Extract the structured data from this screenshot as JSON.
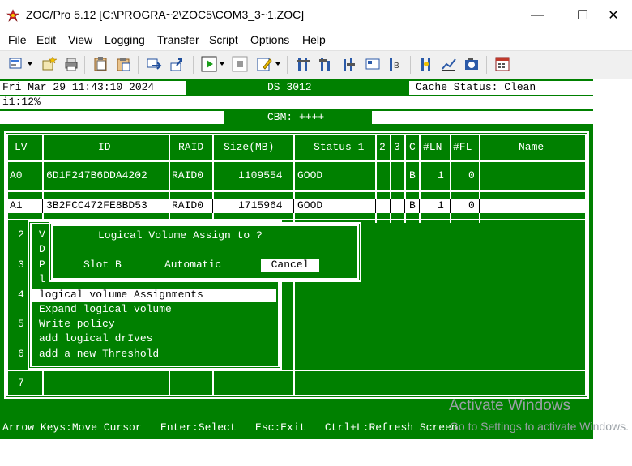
{
  "window": {
    "title": "ZOC/Pro 5.12 [C:\\PROGRA~2\\ZOC5\\COM3_3~1.ZOC]",
    "minimize_glyph": "—",
    "maximize_glyph": "☐",
    "close_glyph": "✕"
  },
  "menu": {
    "items": [
      "File",
      "Edit",
      "View",
      "Logging",
      "Transfer",
      "Script",
      "Options",
      "Help"
    ]
  },
  "toolbar": {
    "icons": [
      "session-icon",
      "new-star-icon",
      "printer-icon",
      "clipboard-icon",
      "clipboard-paste-icon",
      "send-icon",
      "upload-icon",
      "play-icon",
      "stop-icon",
      "edit-icon",
      "hardware-icon",
      "hardware-2-icon",
      "hardware-3-icon",
      "hardware-4-icon",
      "hardware-5-icon",
      "tool-icon",
      "chart-icon",
      "camera-icon",
      "calculator-icon"
    ]
  },
  "terminal": {
    "status_datetime": "Fri Mar 29 11:43:10 2024",
    "status_model": "DS 3012",
    "status_cache": "Cache Status: Clean",
    "status_i1": "i1:12%",
    "status_cbm": "CBM: ++++",
    "table": {
      "headers": [
        "LV",
        "ID",
        "RAID",
        "Size(MB)",
        "Status 1",
        "2",
        "3",
        "C",
        "#LN",
        "#FL",
        "Name"
      ],
      "rows": [
        {
          "lv": "A0",
          "id": "6D1F247B6DDA4202",
          "raid": "RAID0",
          "size": "1109554",
          "status": "GOOD",
          "c": "B",
          "ln": "1",
          "fl": "0",
          "selected": false
        },
        {
          "lv": "A1",
          "id": "3B2FCC472FE8BD53",
          "raid": "RAID0",
          "size": "1715964",
          "status": "GOOD",
          "c": "B",
          "ln": "1",
          "fl": "0",
          "selected": true
        }
      ],
      "empty_rows": [
        "2",
        "3",
        "4",
        "5",
        "6",
        "7"
      ]
    },
    "menu_partial": [
      "V",
      "D",
      "P",
      "l"
    ],
    "menu_items": [
      {
        "label": "logical volume Assignments",
        "selected": true
      },
      {
        "label": "Expand logical volume",
        "selected": false
      },
      {
        "label": "Write policy",
        "selected": false
      },
      {
        "label": "add logical drIves",
        "selected": false
      },
      {
        "label": "add a new Threshold",
        "selected": false
      }
    ],
    "dialog": {
      "title": "Logical Volume Assign to ?",
      "option_1": "Slot B",
      "option_2": "Automatic",
      "cancel": "Cancel"
    },
    "help_line": "Arrow Keys:Move Cursor   Enter:Select   Esc:Exit   Ctrl+L:Refresh Screen"
  },
  "watermark": {
    "line1": "Activate Windows",
    "line2": "Go to Settings to activate Windows."
  },
  "colors": {
    "terminal_bg": "#008000",
    "terminal_fg": "#ffffff",
    "highlight_bg": "#ffffff",
    "highlight_fg": "#000000"
  }
}
